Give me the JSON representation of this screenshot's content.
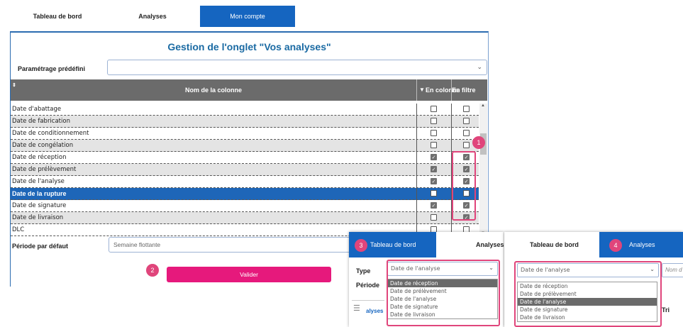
{
  "tabs": [
    "Tableau de bord",
    "Analyses",
    "Mon compte"
  ],
  "panel": {
    "title": "Gestion de l'onglet \"Vos analyses\"",
    "preset_label": "Paramétrage prédéfini",
    "preset_value": "",
    "table": {
      "headers": {
        "name": "Nom de la colonne",
        "in_column": "En colonne",
        "in_filter": "En filtre"
      },
      "rows": [
        {
          "label": "Date d'abattage",
          "col": false,
          "filter": false
        },
        {
          "label": "Date de fabrication",
          "col": false,
          "filter": false
        },
        {
          "label": "Date de conditionnement",
          "col": false,
          "filter": false
        },
        {
          "label": "Date de congélation",
          "col": false,
          "filter": false
        },
        {
          "label": "Date de réception",
          "col": true,
          "filter": true
        },
        {
          "label": "Date de prélèvement",
          "col": true,
          "filter": true
        },
        {
          "label": "Date de l'analyse",
          "col": true,
          "filter": true
        },
        {
          "label": "Date de la rupture",
          "col": false,
          "filter": false
        },
        {
          "label": "Date de signature",
          "col": true,
          "filter": true
        },
        {
          "label": "Date de livraison",
          "col": false,
          "filter": true
        },
        {
          "label": "DLC",
          "col": false,
          "filter": false
        }
      ]
    },
    "period_label": "Période par défaut",
    "period_value": "Semaine flottante",
    "valider": "Valider"
  },
  "badges": [
    "1",
    "2",
    "3",
    "4"
  ],
  "overlay3": {
    "tab_dashboard": "Tableau de bord",
    "tab_analyses": "Analyses",
    "type_label": "Type",
    "type_value": "Date de l'analyse",
    "period_label": "Période",
    "menu_label": "alyses",
    "options": [
      "Date de réception",
      "Date de prélèvement",
      "Date de l'analyse",
      "Date de signature",
      "Date de livraison"
    ]
  },
  "overlay4": {
    "tab_dashboard": "Tableau de bord",
    "tab_analyses": "Analyses",
    "type_value": "Date de l'analyse",
    "name_placeholder": "Nom d",
    "tri_label": "Tri",
    "options": [
      "Date de réception",
      "Date de prélèvement",
      "Date de l'analyse",
      "Date de signature",
      "Date de livraison"
    ]
  },
  "colors": {
    "accent": "#1565c0",
    "pink": "#e6197c",
    "header_gray": "#6b6b6b"
  }
}
